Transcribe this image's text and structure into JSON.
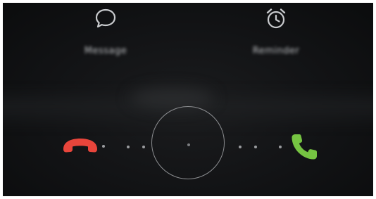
{
  "actions": {
    "message": {
      "label": "Message",
      "icon": "message-bubble-icon"
    },
    "reminder": {
      "label": "Reminder",
      "icon": "alarm-clock-icon"
    }
  },
  "call_controls": {
    "decline": {
      "icon": "hang-up-phone-icon",
      "color": "#e8453b"
    },
    "answer": {
      "icon": "phone-icon",
      "color": "#76c442"
    },
    "slider_dot_color": "#9a9c9f"
  },
  "colors": {
    "background": "#121315",
    "icon": "#c9cbce",
    "ring": "#8c8e91"
  }
}
